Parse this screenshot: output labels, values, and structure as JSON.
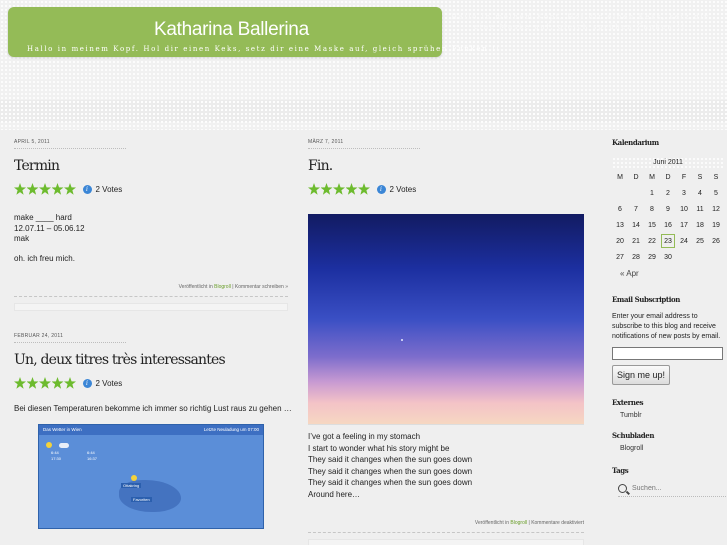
{
  "site": {
    "title": "Katharina Ballerina",
    "tagline": "Hallo in meinem Kopf. Hol dir einen Keks, setz dir eine Maske auf, gleich sprühen Funken !!",
    "tagline_repeat": "Hallo in meinem Kopf. Hol dir einen Keks, setz dir eine Maske auf, gleich sprühen Funken !!"
  },
  "colors": {
    "header_green": "#94bb57",
    "star_green": "#6dbb2e",
    "link_green": "#6a9e2a",
    "info_blue": "#3b86d6"
  },
  "posts": {
    "termin": {
      "date": "April 5, 2011",
      "title": "Termin",
      "votes": "2 Votes",
      "lines": [
        "make ____ hard",
        "12.07.11 – 05.06.12",
        "mak",
        "oh. ich freu mich."
      ],
      "footer_prefix": "Veröffentlicht in",
      "category": "Blogroll",
      "footer_sep": "|",
      "comment_link": "Kommentar schreiben »"
    },
    "fin": {
      "date": "März 7, 2011",
      "title": "Fin.",
      "votes": "2 Votes",
      "lines": [
        "I’ve got a feeling in my stomach",
        "I start to wonder what his story might be",
        "They said it changes when the sun goes down",
        "They said it changes when the sun goes down",
        "They said it changes when the sun goes down",
        "Around here…"
      ],
      "footer_prefix": "Veröffentlicht in",
      "category": "Blogroll",
      "footer_sep": "|",
      "comment_status": "Kommentare deaktiviert"
    },
    "un_deux": {
      "date": "Februar 24, 2011",
      "title": "Un, deux titres très interessantes",
      "votes": "2 Votes",
      "lines": [
        "Bei diesen Temperaturen bekomme ich immer so richtig Lust raus zu gehen …"
      ],
      "weather_widget": {
        "heading": "Das Wetter in Wien",
        "updated": "Letzte Neuladung um 07:00",
        "readings": [
          "6:44",
          "6:44",
          "17:30",
          "16:37"
        ],
        "markers": [
          "Ottakring",
          "Favoriten"
        ]
      }
    }
  },
  "sidebar": {
    "calendar": {
      "title": "Kalendarium",
      "month": "Juni 2011",
      "weekdays": [
        "M",
        "D",
        "M",
        "D",
        "F",
        "S",
        "S"
      ],
      "weeks": [
        [
          "",
          "",
          "1",
          "2",
          "3",
          "4",
          "5"
        ],
        [
          "6",
          "7",
          "8",
          "9",
          "10",
          "11",
          "12"
        ],
        [
          "13",
          "14",
          "15",
          "16",
          "17",
          "18",
          "19"
        ],
        [
          "20",
          "21",
          "22",
          "23",
          "24",
          "25",
          "26"
        ],
        [
          "27",
          "28",
          "29",
          "30",
          "",
          "",
          ""
        ]
      ],
      "today": "23",
      "prev_link": "« Apr"
    },
    "email": {
      "title": "Email Subscription",
      "description": "Enter your email address to subscribe to this blog and receive notifications of new posts by email.",
      "input_value": "",
      "button_label": "Sign me up!"
    },
    "externes": {
      "title": "Externes",
      "link": "Tumblr"
    },
    "schubladen": {
      "title": "Schubladen",
      "link": "Blogroll"
    },
    "tags": {
      "title": "Tags"
    },
    "search": {
      "placeholder": "Suchen..."
    }
  }
}
